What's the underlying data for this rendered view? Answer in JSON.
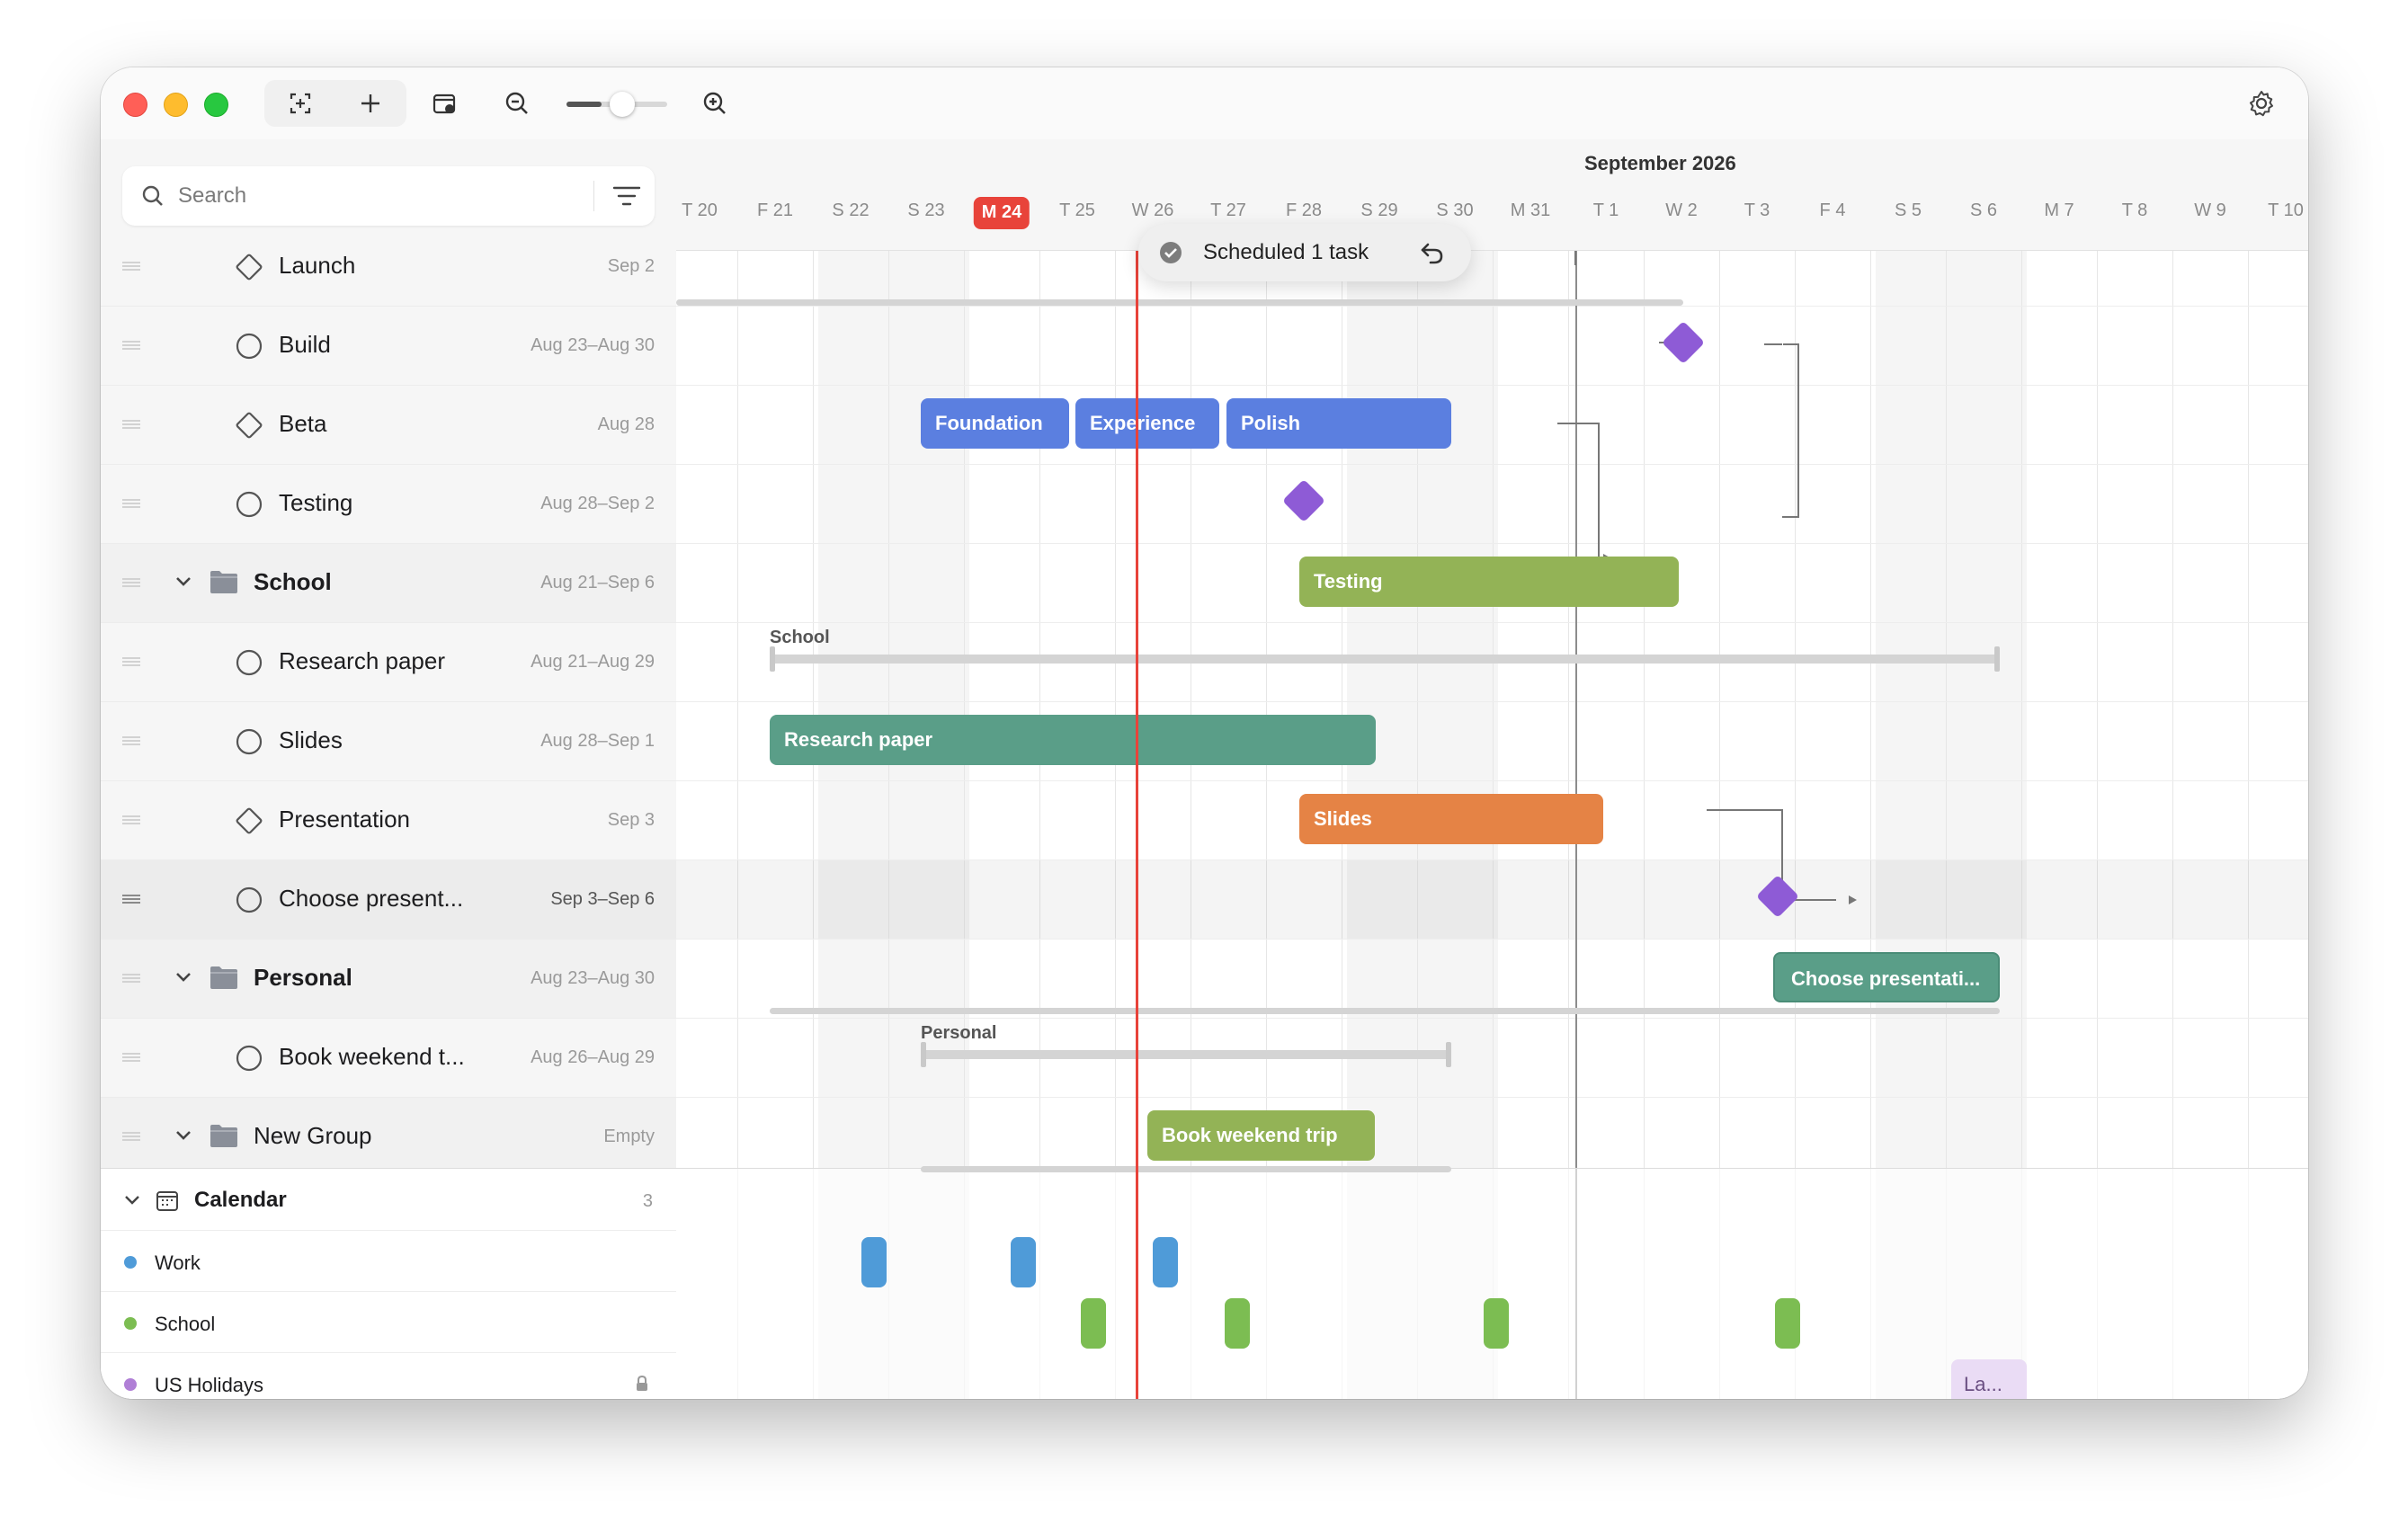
{
  "toolbar": {
    "buttons": [
      "add-task-with-selection-icon",
      "plus-icon",
      "calendar-gear-icon",
      "zoom-out-icon",
      "zoom-in-icon",
      "gear-icon"
    ],
    "zoom_level": 0.35
  },
  "search": {
    "placeholder": "Search",
    "value": ""
  },
  "tasks": [
    {
      "name": "Launch",
      "date": "Sep 2",
      "kind": "milestone"
    },
    {
      "name": "Build",
      "date": "Aug 23–Aug 30",
      "kind": "task"
    },
    {
      "name": "Beta",
      "date": "Aug 28",
      "kind": "milestone"
    },
    {
      "name": "Testing",
      "date": "Aug 28–Sep 2",
      "kind": "task"
    },
    {
      "name": "School",
      "date": "Aug 21–Sep 6",
      "kind": "group"
    },
    {
      "name": "Research paper",
      "date": "Aug 21–Aug 29",
      "kind": "task"
    },
    {
      "name": "Slides",
      "date": "Aug 28–Sep 1",
      "kind": "task"
    },
    {
      "name": "Presentation",
      "date": "Sep 3",
      "kind": "milestone"
    },
    {
      "name": "Choose present...",
      "date": "Sep 3–Sep 6",
      "kind": "task",
      "selected": true
    },
    {
      "name": "Personal",
      "date": "Aug 23–Aug 30",
      "kind": "group"
    },
    {
      "name": "Book weekend t...",
      "date": "Aug 26–Aug 29",
      "kind": "task"
    },
    {
      "name": "New Group",
      "date": "Empty",
      "kind": "group"
    }
  ],
  "calendar": {
    "title": "Calendar",
    "count": "3",
    "items": [
      {
        "label": "Work",
        "color": "#4f9bd8"
      },
      {
        "label": "School",
        "color": "#7cbd52"
      },
      {
        "label": "US Holidays",
        "color": "#b07fd6",
        "locked": true
      }
    ]
  },
  "timeline": {
    "month_label": "September 2026",
    "days": [
      "T 20",
      "F 21",
      "S 22",
      "S 23",
      "M 24",
      "T 25",
      "W 26",
      "T 27",
      "F 28",
      "S 29",
      "S 30",
      "M 31",
      "T 1",
      "W 2",
      "T 3",
      "F 4",
      "S 5",
      "S 6",
      "M 7",
      "T 8",
      "W 9",
      "T 10"
    ],
    "today": "M 24",
    "bars": {
      "foundation": "Foundation",
      "experience": "Experience",
      "polish": "Polish",
      "testing": "Testing",
      "research": "Research paper",
      "slides": "Slides",
      "choose": "Choose presentati...",
      "book": "Book weekend trip"
    },
    "summaries": {
      "school": "School",
      "personal": "Personal"
    },
    "holiday_label": "La...",
    "colors": {
      "blue": "#5b7fe0",
      "green": "#93b356",
      "teal": "#5a9e88",
      "orange": "#e58345",
      "purple": "#8e5bd6",
      "today": "#e8433a"
    }
  },
  "toast": {
    "text": "Scheduled 1 task"
  }
}
